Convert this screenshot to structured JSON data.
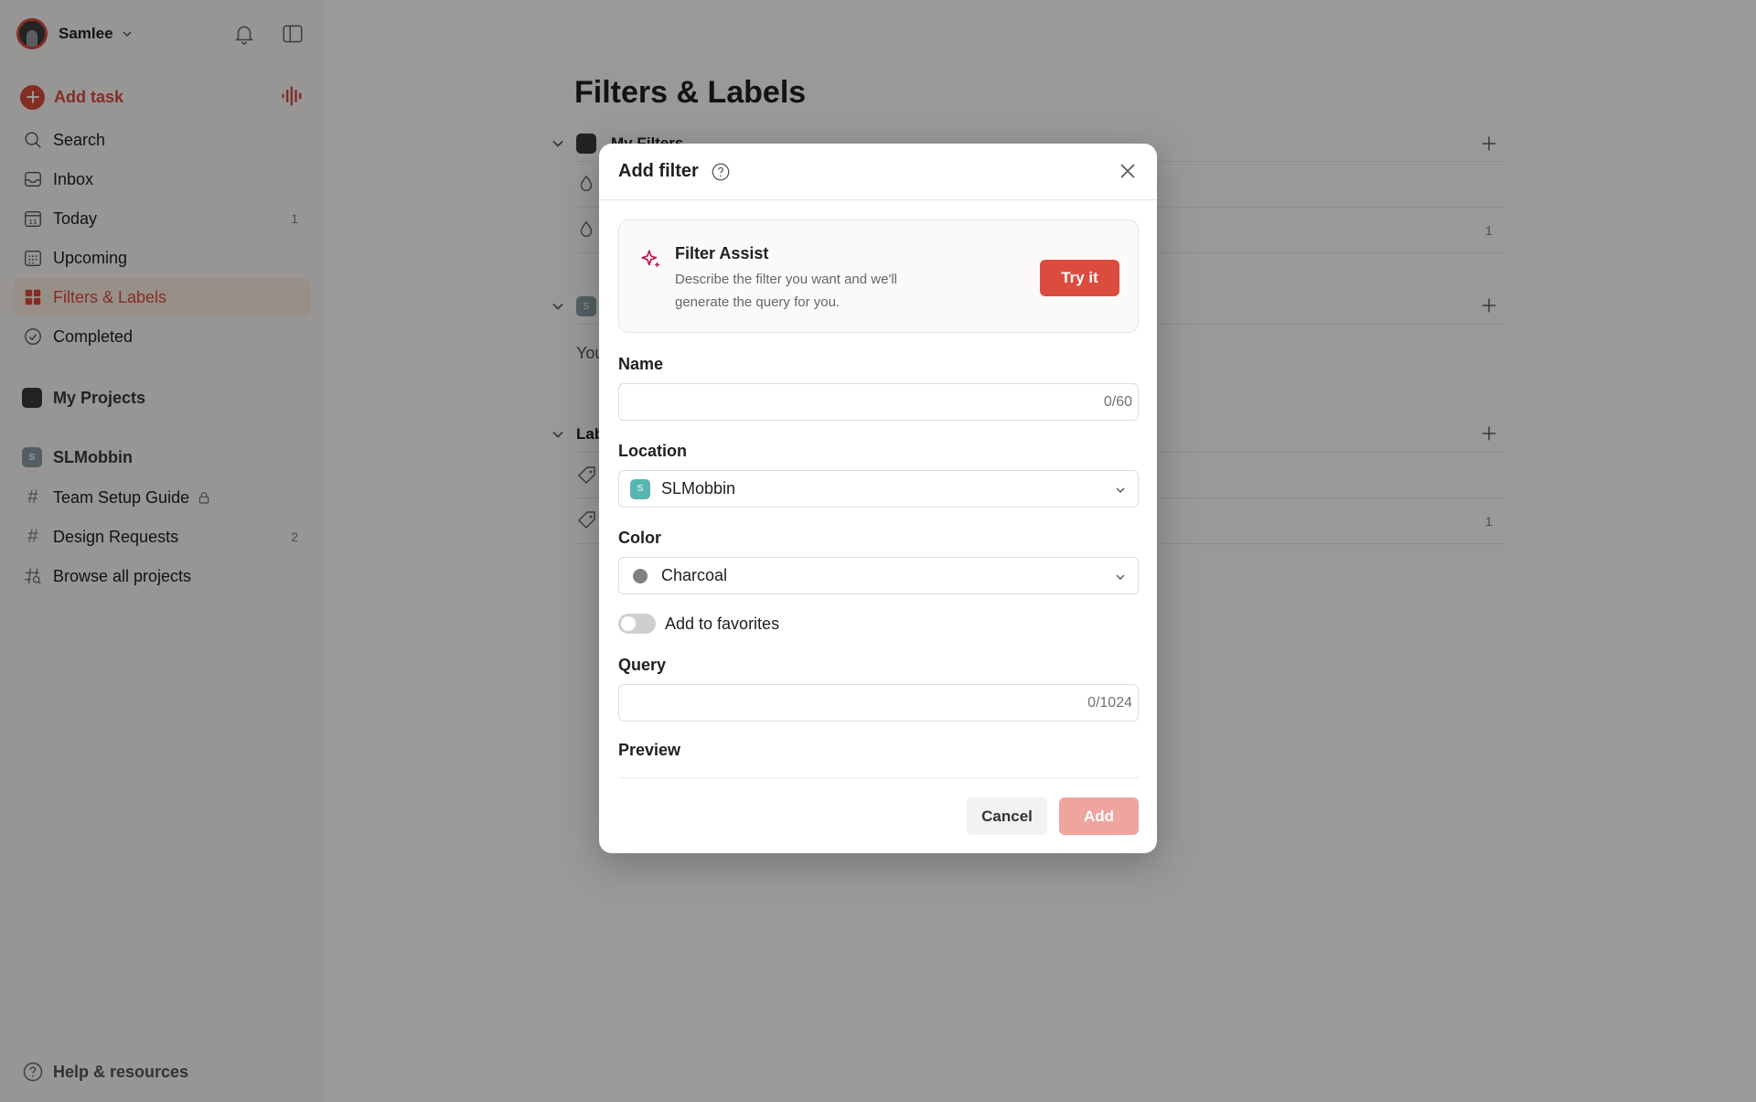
{
  "sidebar": {
    "user_name": "Samlee",
    "add_task": "Add task",
    "nav": [
      {
        "label": "Search",
        "count": ""
      },
      {
        "label": "Inbox",
        "count": ""
      },
      {
        "label": "Today",
        "count": "1",
        "icon_text": "11"
      },
      {
        "label": "Upcoming",
        "count": ""
      },
      {
        "label": "Filters & Labels",
        "count": ""
      },
      {
        "label": "Completed",
        "count": ""
      }
    ],
    "my_projects": "My Projects",
    "workspace": {
      "name": "SLMobbin",
      "initial": "S"
    },
    "projects": [
      {
        "label": "Team Setup Guide",
        "count": ""
      },
      {
        "label": "Design Requests",
        "count": "2"
      },
      {
        "label": "Browse all projects",
        "count": ""
      }
    ],
    "help": "Help & resources"
  },
  "main": {
    "title": "Filters & Labels",
    "sections": {
      "filters_heading": "My Filters",
      "filter_row_2_count": "1",
      "workspace_initial": "S",
      "workspace_text": "You",
      "labels_heading": "Lab",
      "label_row_2_count": "1"
    }
  },
  "modal": {
    "title": "Add filter",
    "assist": {
      "title": "Filter Assist",
      "description": "Describe the filter you want and we'll generate the query for you.",
      "button": "Try it"
    },
    "name": {
      "label": "Name",
      "value": "",
      "counter": "0/60"
    },
    "location": {
      "label": "Location",
      "value": "SLMobbin",
      "initial": "S"
    },
    "color": {
      "label": "Color",
      "value": "Charcoal",
      "swatch": "#808080"
    },
    "favorites": {
      "label": "Add to favorites",
      "on": false
    },
    "query": {
      "label": "Query",
      "value": "",
      "counter": "0/1024"
    },
    "preview": {
      "label": "Preview"
    },
    "cancel": "Cancel",
    "add": "Add"
  },
  "colors": {
    "accent": "#dc4c3e",
    "active_bg": "#ffefe5",
    "overlay": "rgba(0,0,0,0.4)"
  }
}
